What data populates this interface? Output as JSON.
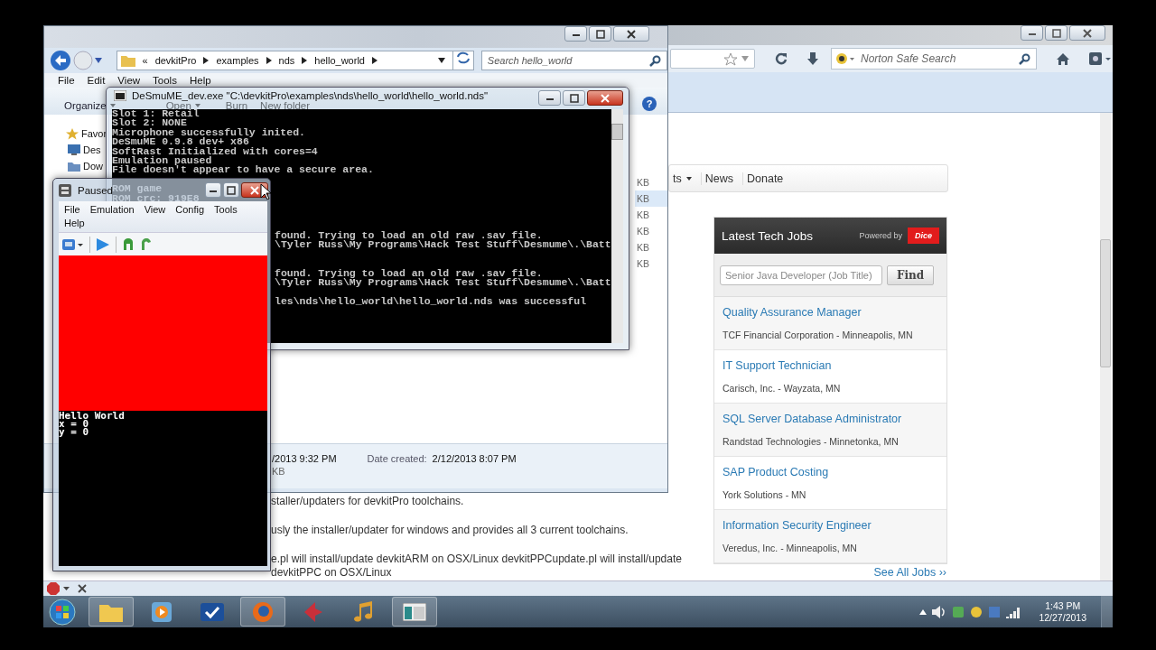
{
  "browser": {
    "search_placeholder": "Norton Safe Search",
    "nav_items": [
      {
        "label": "ts",
        "dropdown": true
      },
      {
        "label": "News",
        "dropdown": false
      },
      {
        "label": "Donate",
        "dropdown": false
      }
    ],
    "page_lines": [
      "staller/updaters for devkitPro toolchains.",
      "usly the installer/updater for windows and provides all 3 current toolchains.",
      "e.pl will install/update devkitARM on OSX/Linux devkitPPCupdate.pl will install/update",
      "devkitPPC on OSX/Linux"
    ],
    "jobs": {
      "title": "Latest Tech Jobs",
      "powered_by": "Powered by",
      "brand": "Dice",
      "search_placeholder": "Senior Java Developer (Job Title)",
      "button": "Find",
      "items": [
        {
          "title": "Quality Assurance Manager",
          "company": "TCF Financial Corporation - Minneapolis, MN"
        },
        {
          "title": "IT Support Technician",
          "company": "Carisch, Inc. - Wayzata, MN"
        },
        {
          "title": "SQL Server Database Administrator",
          "company": "Randstad Technologies - Minnetonka, MN"
        },
        {
          "title": "SAP Product Costing",
          "company": "York Solutions - MN"
        },
        {
          "title": "Information Security Engineer",
          "company": "Veredus, Inc. - Minneapolis, MN"
        }
      ],
      "see_all": "See All Jobs ››"
    }
  },
  "explorer": {
    "back_more": "«",
    "breadcrumb": [
      "devkitPro",
      "examples",
      "nds",
      "hello_world"
    ],
    "search_placeholder": "Search hello_world",
    "menu": [
      "File",
      "Edit",
      "View",
      "Tools",
      "Help"
    ],
    "toolbar": [
      {
        "label": "Organize",
        "dropdown": true
      },
      {
        "label": "Open",
        "dropdown": true
      },
      {
        "label": "Burn",
        "dropdown": false
      },
      {
        "label": "New folder",
        "dropdown": false
      }
    ],
    "help": "?",
    "sidebar": [
      "Favor",
      "Des",
      "Dow"
    ],
    "sizes": [
      {
        "text": "KB",
        "selected": false
      },
      {
        "text": "KB",
        "selected": true
      },
      {
        "text": "KB",
        "selected": false
      },
      {
        "text": "KB",
        "selected": false
      },
      {
        "text": "KB",
        "selected": false
      },
      {
        "text": "KB",
        "selected": false
      }
    ],
    "details": {
      "modified": "/2013 9:32 PM",
      "created_label": "Date created:",
      "created": "2/12/2013 8:07 PM",
      "size": "KB"
    }
  },
  "console": {
    "title": "DeSmuME_dev.exe \"C:\\devkitPro\\examples\\nds\\hello_world\\hello_world.nds\"",
    "lines": [
      {
        "kind": "full",
        "text": "Slot 1: Retail"
      },
      {
        "kind": "full",
        "text": "Slot 2: NONE"
      },
      {
        "kind": "full",
        "text": "Microphone successfully inited."
      },
      {
        "kind": "full",
        "text": "DeSmuME 0.9.8 dev+ x86"
      },
      {
        "kind": "full",
        "text": "SoftRast Initialized with cores=4"
      },
      {
        "kind": "full",
        "text": "Emulation paused"
      },
      {
        "kind": "full",
        "text": "File doesn't appear to have a secure area."
      },
      {
        "kind": "hidden"
      },
      {
        "kind": "full",
        "text": "ROM game"
      },
      {
        "kind": "full",
        "text": "ROM crc: 919E8"
      },
      {
        "kind": "hidden"
      },
      {
        "kind": "hidden"
      },
      {
        "kind": "hidden"
      },
      {
        "kind": "cut",
        "text": "found. Trying to load an old raw .sav file."
      },
      {
        "kind": "cut",
        "text": "\\Tyler Russ\\My Programs\\Hack Test Stuff\\Desmume\\.\\Batt"
      },
      {
        "kind": "hidden"
      },
      {
        "kind": "hidden"
      },
      {
        "kind": "cut",
        "text": "found. Trying to load an old raw .sav file."
      },
      {
        "kind": "cut",
        "text": "\\Tyler Russ\\My Programs\\Hack Test Stuff\\Desmume\\.\\Batt"
      },
      {
        "kind": "hidden"
      },
      {
        "kind": "cut",
        "text": "les\\nds\\hello_world\\hello_world.nds was successful"
      }
    ]
  },
  "emulator": {
    "title": "Paused",
    "menu": [
      "File",
      "Emulation",
      "View",
      "Config",
      "Tools",
      "Help"
    ],
    "bottom_lines": [
      "Hello World",
      "x = 0",
      "y = 0"
    ]
  },
  "taskbar": {
    "time": "1:43 PM",
    "date": "12/27/2013"
  }
}
